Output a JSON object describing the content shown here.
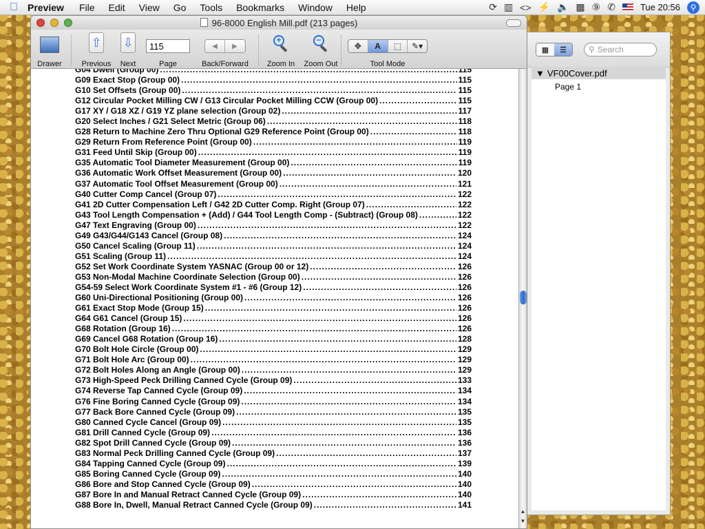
{
  "menubar": {
    "app": "Preview",
    "items": [
      "File",
      "Edit",
      "View",
      "Go",
      "Tools",
      "Bookmarks",
      "Window",
      "Help"
    ],
    "clock": "Tue 20:56"
  },
  "window": {
    "title": "96-8000 English Mill.pdf (213 pages)"
  },
  "toolbar": {
    "drawer": "Drawer",
    "previous": "Previous",
    "next": "Next",
    "page_value": "115",
    "page": "Page",
    "back_forward": "Back/Forward",
    "zoom_in": "Zoom In",
    "zoom_out": "Zoom Out",
    "tool_mode": "Tool Mode",
    "text_mode": "A"
  },
  "drawer": {
    "search_placeholder": "Search",
    "document": "VF00Cover.pdf",
    "page": "Page 1"
  },
  "toc": [
    {
      "title": "G04 Dwell (Group 00)",
      "page": "115"
    },
    {
      "title": "G09 Exact Stop (Group 00)",
      "page": "115"
    },
    {
      "title": "G10 Set Offsets (Group 00)",
      "page": "115"
    },
    {
      "title": "G12 Circular Pocket Milling CW / G13 Circular Pocket Milling CCW (Group 00)",
      "page": "115"
    },
    {
      "title": "G17 XY / G18 XZ / G19 YZ plane selection (Group 02)",
      "page": "117"
    },
    {
      "title": "G20 Select Inches / G21 Select Metric (Group 06)",
      "page": "118"
    },
    {
      "title": "G28 Return to Machine Zero Thru Optional G29 Reference Point (Group 00)",
      "page": "118"
    },
    {
      "title": "G29 Return From Reference Point (Group 00)",
      "page": "119"
    },
    {
      "title": "G31 Feed Until Skip (Group 00)",
      "page": "119"
    },
    {
      "title": "G35 Automatic Tool Diameter Measurement  (Group 00)",
      "page": "119"
    },
    {
      "title": "G36 Automatic Work Offset Measurement (Group 00)",
      "page": "120"
    },
    {
      "title": "G37 Automatic Tool Offset Measurement  (Group 00)",
      "page": "121"
    },
    {
      "title": "G40 Cutter Comp Cancel (Group 07)",
      "page": "122"
    },
    {
      "title": "G41 2D Cutter Compensation Left / G42 2D Cutter Comp. Right (Group 07)",
      "page": "122"
    },
    {
      "title": "G43 Tool Length Compensation + (Add) / G44 Tool Length Comp - (Subtract) (Group 08)",
      "page": "122"
    },
    {
      "title": "G47 Text Engraving (Group 00)",
      "page": "122"
    },
    {
      "title": "G49 G43/G44/G143 Cancel (Group 08)",
      "page": "124"
    },
    {
      "title": "G50 Cancel Scaling (Group 11)",
      "page": "124"
    },
    {
      "title": "G51 Scaling (Group 11)",
      "page": "124"
    },
    {
      "title": "G52 Set Work Coordinate System YASNAC (Group 00 or 12)",
      "page": "126"
    },
    {
      "title": "G53 Non-Modal Machine Coordinate Selection (Group 00)",
      "page": "126"
    },
    {
      "title": "G54-59 Select Work Coordinate System #1 - #6 (Group 12)",
      "page": "126"
    },
    {
      "title": "G60 Uni-Directional Positioning (Group 00)",
      "page": "126"
    },
    {
      "title": "G61 Exact Stop Mode (Group 15)",
      "page": "126"
    },
    {
      "title": "G64 G61 Cancel (Group 15)",
      "page": "126"
    },
    {
      "title": "G68 Rotation (Group 16)",
      "page": "126"
    },
    {
      "title": "G69 Cancel G68 Rotation (Group 16)",
      "page": "128"
    },
    {
      "title": "G70 Bolt Hole Circle (Group 00)",
      "page": "129"
    },
    {
      "title": "G71 Bolt Hole Arc (Group 00)",
      "page": "129"
    },
    {
      "title": "G72 Bolt Holes Along an Angle (Group 00)",
      "page": "129"
    },
    {
      "title": "G73 High-Speed Peck Drilling Canned Cycle (Group 09)",
      "page": "133"
    },
    {
      "title": "G74 Reverse Tap Canned Cycle (Group 09)",
      "page": "134"
    },
    {
      "title": "G76 Fine Boring Canned Cycle (Group 09)",
      "page": "134"
    },
    {
      "title": "G77 Back Bore Canned Cycle (Group 09)",
      "page": "135"
    },
    {
      "title": "G80 Canned Cycle Cancel (Group 09)",
      "page": "135"
    },
    {
      "title": "G81 Drill Canned Cycle (Group 09)",
      "page": "136"
    },
    {
      "title": "G82 Spot Drill Canned Cycle (Group 09)",
      "page": "136"
    },
    {
      "title": "G83 Normal Peck Drilling Canned Cycle (Group 09)",
      "page": "137"
    },
    {
      "title": "G84 Tapping Canned Cycle (Group 09)",
      "page": "139"
    },
    {
      "title": "G85 Boring Canned Cycle (Group 09)",
      "page": "140"
    },
    {
      "title": "G86 Bore and Stop Canned Cycle (Group 09)",
      "page": "140"
    },
    {
      "title": "G87 Bore In and Manual Retract Canned Cycle (Group 09)",
      "page": "140"
    },
    {
      "title": "G88 Bore In, Dwell, Manual Retract Canned Cycle (Group 09)",
      "page": "141"
    }
  ]
}
